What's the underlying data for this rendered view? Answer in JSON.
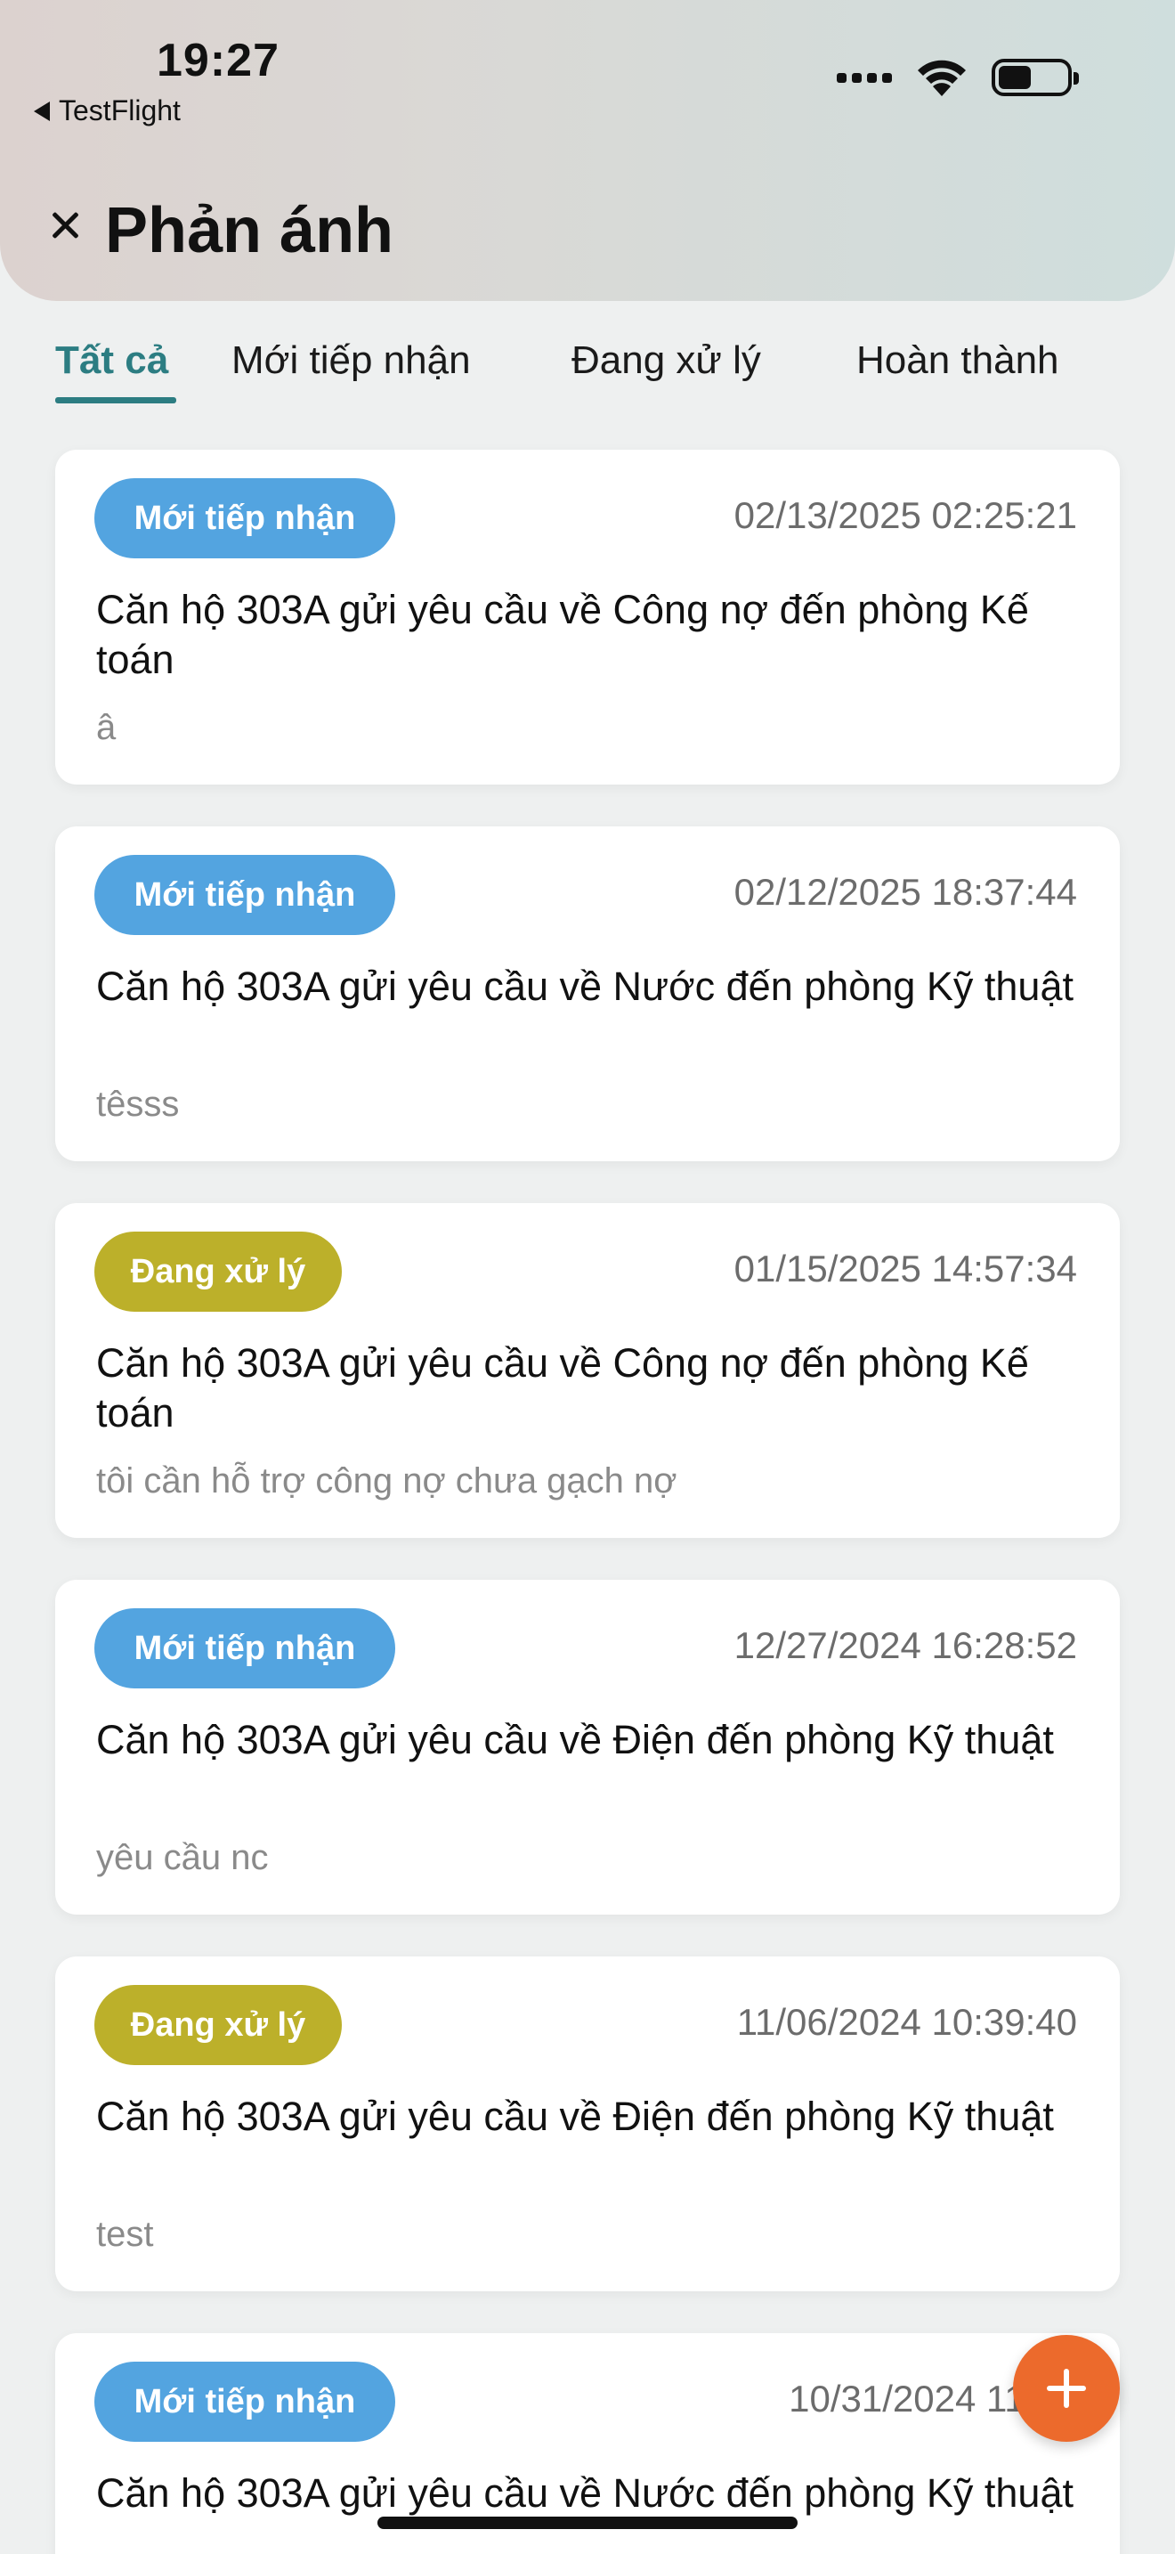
{
  "status_bar": {
    "time": "19:27",
    "back_app": "TestFlight",
    "icons": [
      "cellular-signal-icon",
      "wifi-icon",
      "battery-icon"
    ]
  },
  "header": {
    "close_icon": "close-icon",
    "title": "Phản ánh"
  },
  "tabs": [
    {
      "label": "Tất cả",
      "active": true
    },
    {
      "label": "Mới tiếp nhận",
      "active": false
    },
    {
      "label": "Đang xử lý",
      "active": false
    },
    {
      "label": "Hoàn thành",
      "active": false
    }
  ],
  "colors": {
    "accent": "#2c7d82",
    "status_new": "#53a4e0",
    "status_processing": "#bcb02a",
    "fab": "#ec6a2c"
  },
  "requests": [
    {
      "status": "Mới tiếp nhận",
      "status_type": "new",
      "datetime": "02/13/2025 02:25:21",
      "title": "Căn hộ 303A gửi yêu cầu về Công nợ đến phòng Kế toán",
      "description": "â"
    },
    {
      "status": "Mới tiếp nhận",
      "status_type": "new",
      "datetime": "02/12/2025 18:37:44",
      "title": "Căn hộ 303A gửi yêu cầu về Nước đến phòng Kỹ thuật",
      "description": "têsss"
    },
    {
      "status": "Đang xử lý",
      "status_type": "processing",
      "datetime": "01/15/2025 14:57:34",
      "title": "Căn hộ 303A gửi yêu cầu về Công nợ đến phòng Kế toán",
      "description": "tôi cần hỗ trợ công nợ chưa gạch nợ"
    },
    {
      "status": "Mới tiếp nhận",
      "status_type": "new",
      "datetime": "12/27/2024 16:28:52",
      "title": "Căn hộ 303A gửi yêu cầu về Điện đến phòng Kỹ thuật",
      "description": "yêu cầu nc"
    },
    {
      "status": "Đang xử lý",
      "status_type": "processing",
      "datetime": "11/06/2024 10:39:40",
      "title": "Căn hộ 303A gửi yêu cầu về Điện đến phòng Kỹ thuật",
      "description": "test"
    },
    {
      "status": "Mới tiếp nhận",
      "status_type": "new",
      "datetime": "10/31/2024 11:19",
      "title": "Căn hộ 303A gửi yêu cầu về Nước đến phòng Kỹ thuật",
      "description": ""
    }
  ],
  "fab": {
    "icon": "plus-icon"
  }
}
